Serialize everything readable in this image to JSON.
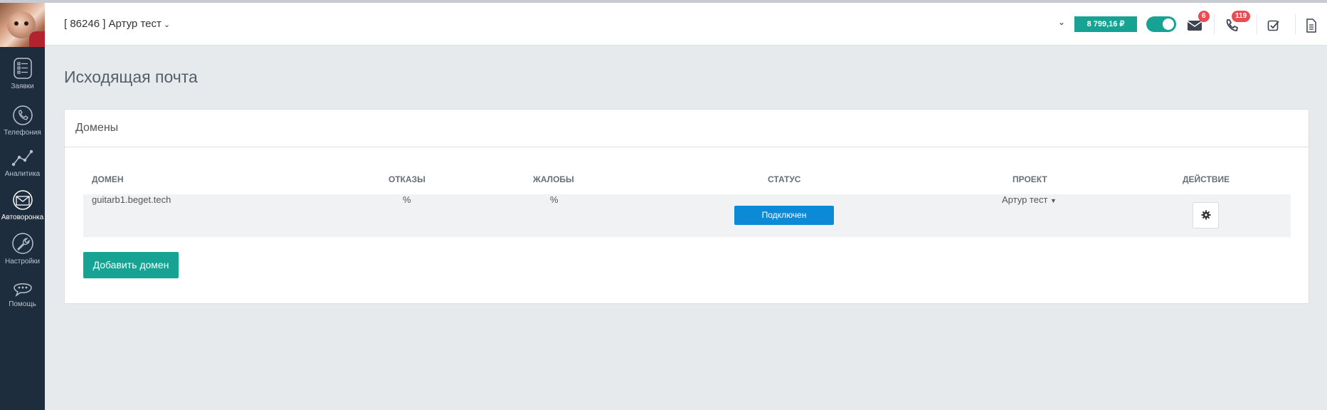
{
  "sidebar": {
    "items": [
      {
        "label": "Заявки",
        "icon": "requests-icon"
      },
      {
        "label": "Телефония",
        "icon": "phone-icon"
      },
      {
        "label": "Аналитика",
        "icon": "analytics-icon"
      },
      {
        "label": "Автоворонка",
        "icon": "funnel-mail-icon"
      },
      {
        "label": "Настройки",
        "icon": "wrench-icon"
      },
      {
        "label": "Помощь",
        "icon": "chat-icon"
      }
    ],
    "active_index": 3
  },
  "header": {
    "account": "[ 86246 ] Артур тест",
    "balance": "8 799,16 ₽",
    "mail_badge": "6",
    "phone_badge": "119"
  },
  "page": {
    "title": "Исходящая почта"
  },
  "domains": {
    "panel_title": "Домены",
    "columns": [
      "ДОМЕН",
      "ОТКАЗЫ",
      "ЖАЛОБЫ",
      "СТАТУС",
      "ПРОЕКТ",
      "ДЕЙСТВИЕ"
    ],
    "rows": [
      {
        "domain": "guitarb1.beget.tech",
        "bounces": "%",
        "complaints": "%",
        "status": "Подключен",
        "project": "Артур тест"
      }
    ],
    "add_button": "Добавить домен"
  },
  "colors": {
    "sidebar": "#1e2d3e",
    "accent": "#16a394",
    "status_blue": "#0d8ad6",
    "badge_red": "#ea4b54"
  }
}
